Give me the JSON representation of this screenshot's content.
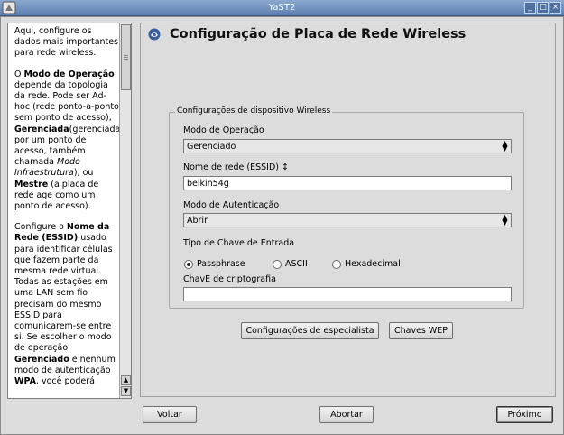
{
  "window": {
    "title": "YaST2"
  },
  "icons": {
    "app": "yast-app-icon",
    "minimize": "minimize-icon",
    "maximize": "maximize-icon",
    "close": "close-icon",
    "logo": "yast-logo-icon",
    "combo": "combo-arrow-icon"
  },
  "help": {
    "p1": "Aqui, configure os dados mais importantes para rede wireless.",
    "p2_a": "O ",
    "p2_b": "Modo de Operação",
    "p2_c": " depende da topologia da rede. Pode ser Ad-hoc (rede ponto-a-ponto sem ponto de acesso), ",
    "p2_d": "Gerenciada",
    "p2_e": "(gerenciada por um ponto de acesso, também chamada ",
    "p2_f": "Modo Infraestrutura",
    "p2_g": "), ou ",
    "p2_h": "Mestre",
    "p2_i": " (a placa de rede age como um ponto de acesso).",
    "p3_a": "Configure o ",
    "p3_b": "Nome da Rede (ESSID)",
    "p3_c": " usado para identificar células que fazem parte da mesma rede virtual. Todas as estações em uma LAN sem fio precisam do mesmo ESSID para comunicarem-se entre si. Se escolher o modo de operação ",
    "p3_d": "Gerenciado",
    "p3_e": " e nenhum modo de autenticação ",
    "p3_f": "WPA",
    "p3_g": ", você poderá"
  },
  "main": {
    "heading": "Configuração de Placa de Rede Wireless",
    "group_title": "Configurações de dispositivo Wireless",
    "mode_label": "Modo de Operação",
    "mode_value": "Gerenciado",
    "essid_label": "Nome de rede (ESSID) ↕",
    "essid_value": "belkin54g",
    "auth_label": "Modo de Autenticação",
    "auth_value": "Abrir",
    "key_type_label": "Tipo de Chave de Entrada",
    "radio_passphrase": "Passphrase",
    "radio_ascii": "ASCII",
    "radio_hex": "Hexadecimal",
    "key_label": "ChavE de criptografia",
    "key_value": "",
    "expert_button": "Configurações de especialista",
    "wep_button": "Chaves WEP"
  },
  "footer": {
    "back": "Voltar",
    "abort": "Abortar",
    "next": "Próximo"
  }
}
